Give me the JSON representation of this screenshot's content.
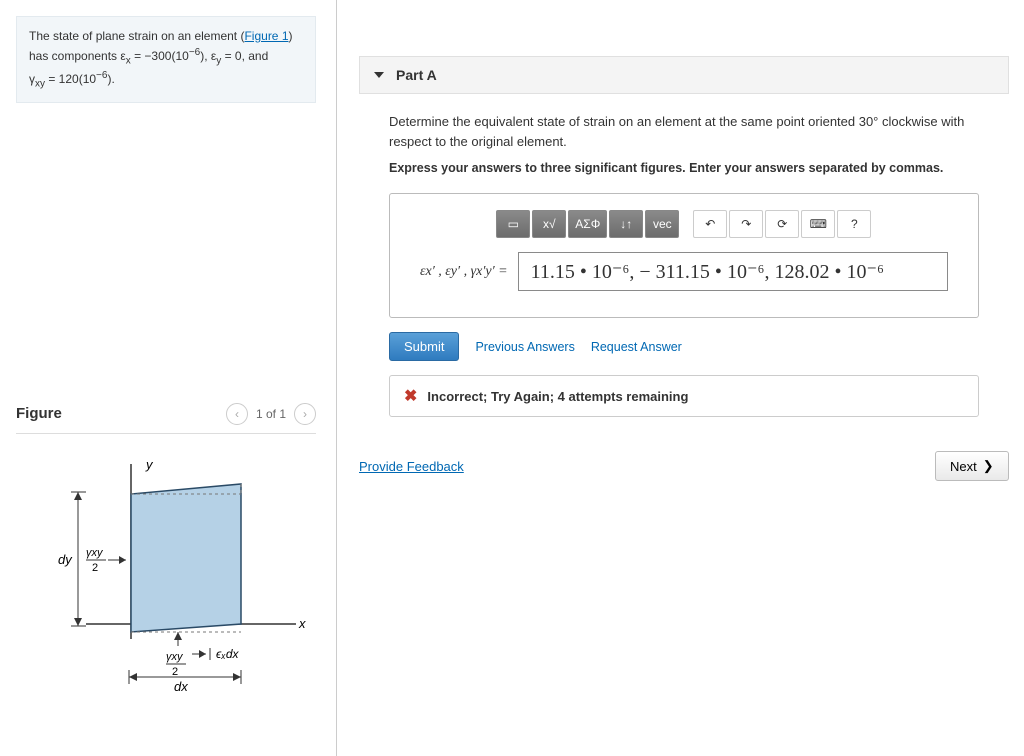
{
  "left": {
    "statement_pre": "The state of plane strain on an element (",
    "figure_link": "Figure 1",
    "statement_post": ") has components ε",
    "ex_sub": "x",
    "eq1": " = −300(10",
    "exp1": "−6",
    "mid1": "), ε",
    "ey_sub": "y",
    "eq2": " = 0, and",
    "line2a": "γ",
    "gxy_sub": "xy",
    "line2b": " = 120(10",
    "exp2": "−6",
    "line2c": ")."
  },
  "figure": {
    "title": "Figure",
    "pager": "1 of 1",
    "labels": {
      "y": "y",
      "x": "x",
      "dy": "dy",
      "dx": "dx",
      "gxy2a": "γxy",
      "half": "2",
      "exdx": "εₓdx"
    }
  },
  "partA": {
    "title": "Part A",
    "statement": "Determine the equivalent state of strain on an element at the same point oriented 30° clockwise with respect to the original element.",
    "instruction": "Express your answers to three significant figures. Enter your answers separated by commas.",
    "toolbar": {
      "tpl": "▭",
      "frac": "x√",
      "greek": "ΑΣΦ",
      "sub": "↓↑",
      "vec": "vec",
      "undo": "↶",
      "redo": "↷",
      "reset": "⟳",
      "kbd": "⌨",
      "help": "?"
    },
    "answer_label": "εx′ , εy′ , γx′y′  =",
    "answer_value": "11.15 • 10⁻⁶, − 311.15 • 10⁻⁶, 128.02 • 10⁻⁶",
    "submit": "Submit",
    "prev": "Previous Answers",
    "req": "Request Answer",
    "feedback": "Incorrect; Try Again; 4 attempts remaining"
  },
  "footer": {
    "provide": "Provide Feedback",
    "next": "Next"
  }
}
